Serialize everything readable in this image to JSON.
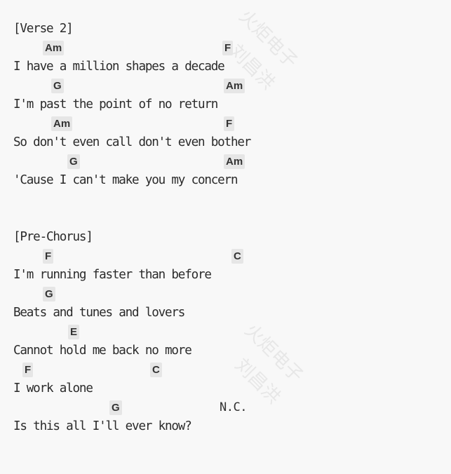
{
  "watermark": {
    "line1": "火炬电子",
    "line2": "刘昌洪"
  },
  "verse2": {
    "header": "[Verse 2]",
    "lines": [
      {
        "chords": [
          "Am",
          "F"
        ],
        "lyric": "I have a million shapes a decade"
      },
      {
        "chords": [
          "G",
          "Am"
        ],
        "lyric": "I'm past the point of no return"
      },
      {
        "chords": [
          "Am",
          "F"
        ],
        "lyric": "So don't even call don't even bother"
      },
      {
        "chords": [
          "G",
          "Am"
        ],
        "lyric": "'Cause I can't make you my concern"
      }
    ]
  },
  "prechorus": {
    "header": "[Pre-Chorus]",
    "lines": [
      {
        "chords": [
          "F",
          "C"
        ],
        "lyric": "I'm running faster than before"
      },
      {
        "chords": [
          "G"
        ],
        "lyric": "Beats and tunes and lovers"
      },
      {
        "chords": [
          "E"
        ],
        "lyric": "Cannot hold me back no more"
      },
      {
        "chords": [
          "F",
          "C"
        ],
        "lyric": "I work alone"
      },
      {
        "chords": [
          "G"
        ],
        "nc": "N.C.",
        "lyric": "Is this all I'll ever know?"
      }
    ]
  }
}
